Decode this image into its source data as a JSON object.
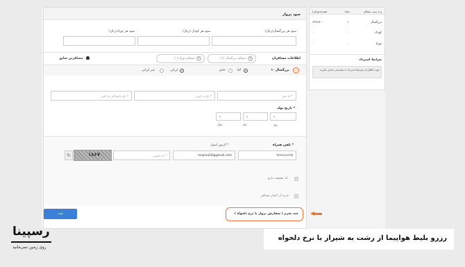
{
  "profit": {
    "title": "سود پرواز",
    "adult_label": "سود هر بزرگسال(ریال)",
    "child_label": "سود هر کودک (ریال)",
    "infant_label": "سود هر نوزاد(ریال)"
  },
  "price_table": {
    "headers": [
      "رده سنی مسافر",
      "تعداد",
      "قیمت(تومان)"
    ],
    "rows": [
      [
        "بزرگسال",
        "۱",
        "۶۲۷,۵۰۰"
      ],
      [
        "کودک",
        "۰",
        "۰"
      ],
      [
        "نوزاد",
        "۰",
        "۰"
      ]
    ]
  },
  "refund": {
    "title": "شرایط استرداد",
    "text": "جهت اطلاع از شرایط استرداد با پشتیبانی تماس بگیرید."
  },
  "passengers": {
    "title": "اطلاعات مسافران",
    "add_adult": "مسافر بزرگسال (۱)",
    "add_infant": "مسافر نوزاد (۰)",
    "previous": "مسافرین سابق",
    "row_label": "۱- بزرگسال",
    "gender_male": "آقا",
    "gender_female": "خانم",
    "nat_iranian": "ایرانی",
    "nat_foreign": "غیر ایرانی",
    "national_code_ph": "کد ملی *",
    "first_name_ph": "نام به لاتین *",
    "last_name_ph": "نام خانوادگی به لاتین *",
    "birth_label": "تاریخ تولد *",
    "day_label": "روز",
    "month_label": "ماه",
    "year_label": "سال"
  },
  "contact": {
    "mobile_label": "تلفن همراه *",
    "mobile_value": "۹۳۶۸۸۱۸۶۲۵",
    "email_label": "آدرس ایمیل *",
    "email_value": "respina24@gmail.com",
    "security_ph": "کد امنیتی *",
    "captcha": "۱۸۶۷",
    "discount": "کد تخفیف دارم.",
    "credit": "خرید از اعتبار مسافر"
  },
  "actions": {
    "submit": "ثبت",
    "custom_price": "چند بخرم ( سفارش پرواز با نرخ دلخواه )"
  },
  "branding": {
    "logo": "رسپینا",
    "slogan": "روی زمین نمی‌مانید",
    "caption": "رزرو بلیط هواپیما از رشت به شیراز با نرخ دلخواه"
  },
  "colors": {
    "accent": "#e8743b",
    "submit": "#3a80d6"
  }
}
